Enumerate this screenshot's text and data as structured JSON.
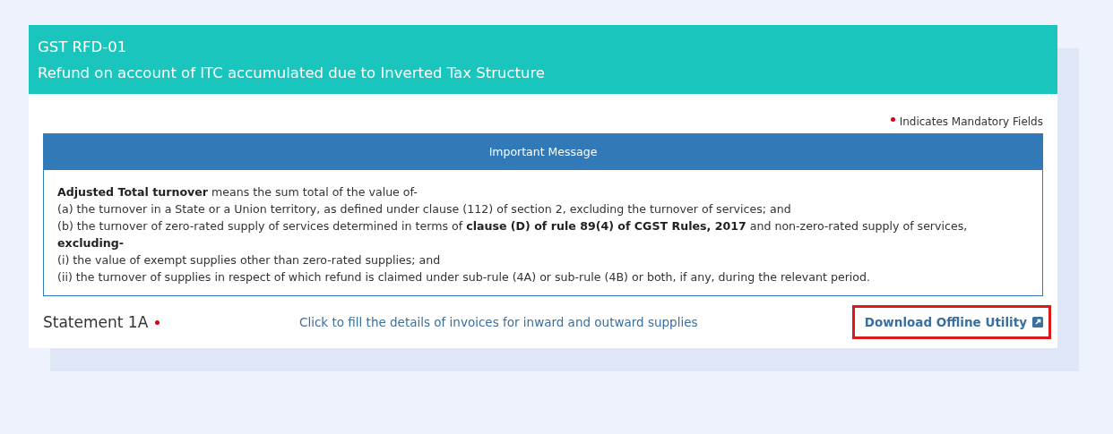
{
  "header": {
    "form_code": "GST RFD-01",
    "title": "Refund on account of ITC accumulated due to Inverted Tax Structure"
  },
  "mandatory_note": "Indicates Mandatory Fields",
  "message": {
    "title": "Important Message",
    "lines": [
      "**Adjusted Total turnover** means the sum total of the value of-",
      "(a) the turnover in a State or a Union territory, as defined under clause (112) of section 2, excluding the turnover of services; and",
      "(b) the turnover of zero-rated supply of services determined in terms of **clause (D) of rule 89(4) of CGST Rules, 2017** and non-zero-rated supply of services,",
      "**excluding-**",
      "(i) the value of exempt supplies other than zero-rated supplies; and",
      "(ii) the turnover of supplies in respect of which refund is claimed under sub-rule (4A) or sub-rule (4B) or both, if any, during the relevant period."
    ]
  },
  "statement": {
    "label": "Statement 1A",
    "mandatory": true,
    "link": "Click to fill the details of invoices for inward and outward supplies",
    "download": {
      "label": "Download Offline Utility",
      "highlighted": true
    }
  }
}
